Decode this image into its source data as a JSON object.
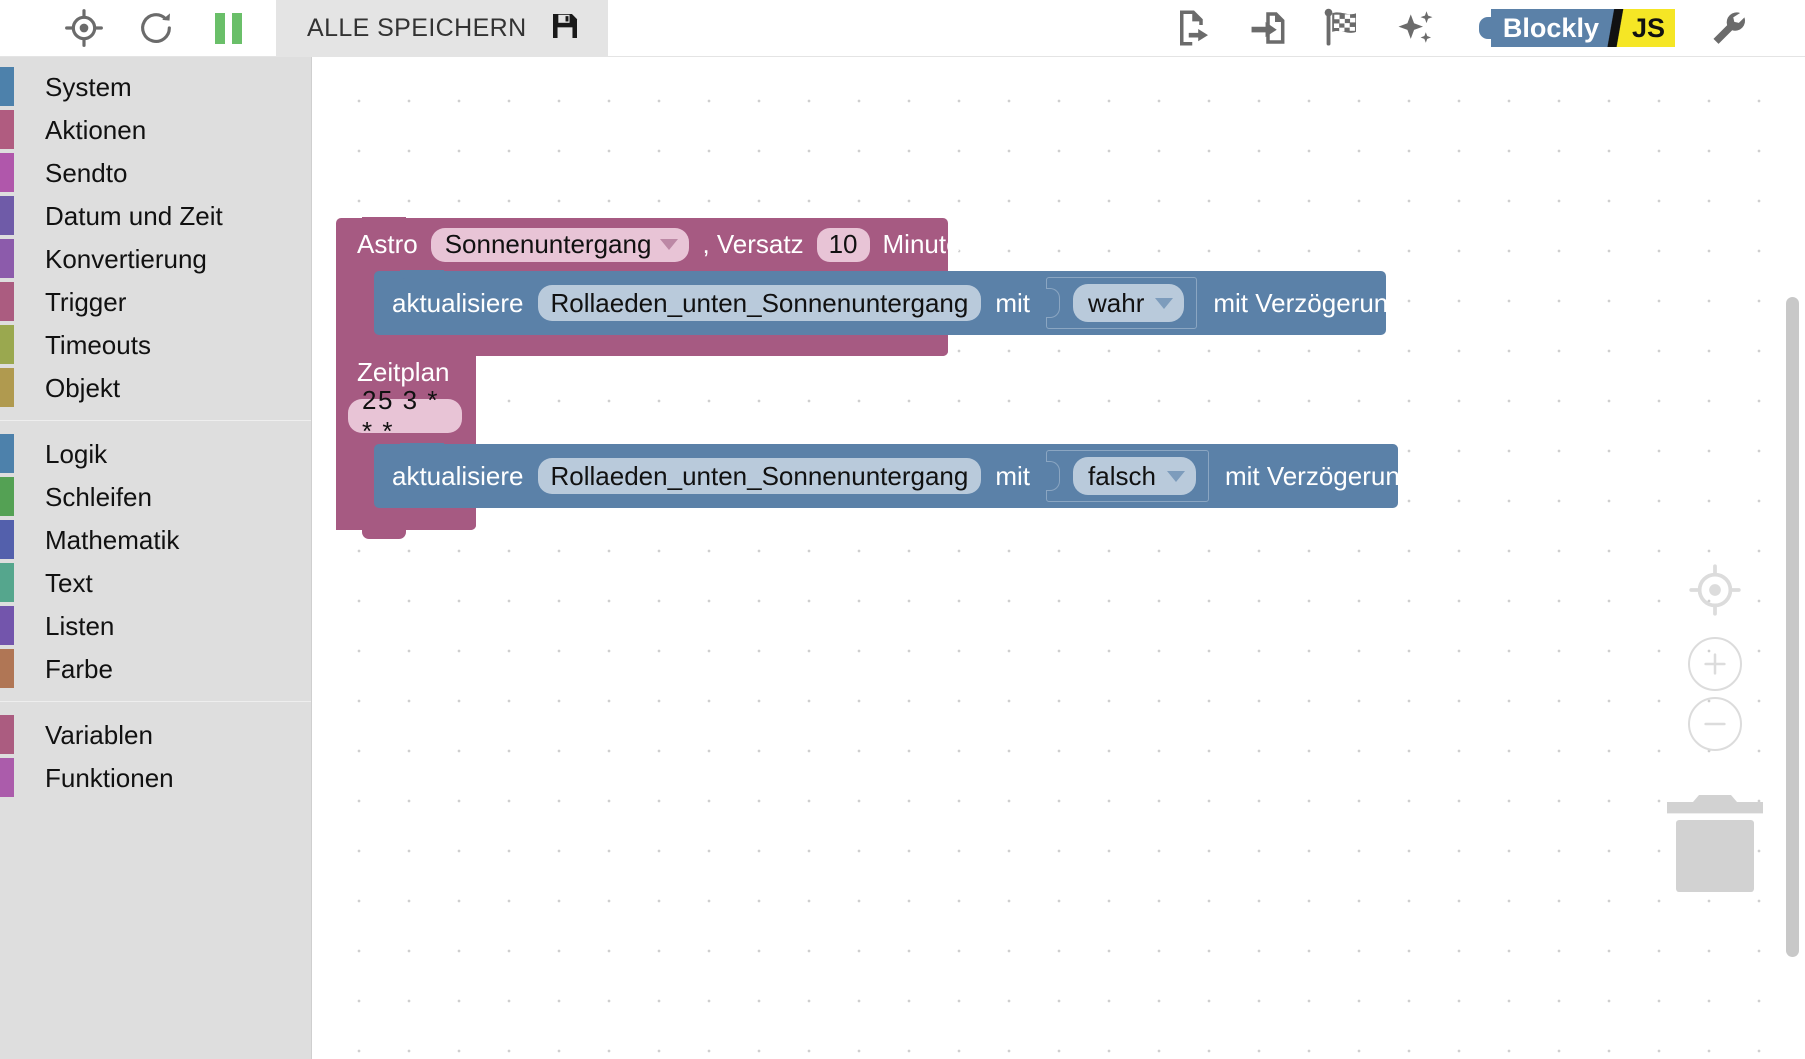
{
  "toolbar": {
    "left_icons": [
      {
        "name": "locate-icon",
        "title": "locate"
      },
      {
        "name": "reload-icon",
        "title": "reload"
      },
      {
        "name": "pause-icon",
        "title": "pause"
      }
    ],
    "save_all_label": "ALLE SPEICHERN",
    "save_icon": "floppy-disk-icon",
    "right_icons": [
      {
        "name": "export-blocks-icon",
        "title": "export"
      },
      {
        "name": "import-blocks-icon",
        "title": "import"
      },
      {
        "name": "checkered-flag-icon",
        "title": "checkpoint"
      },
      {
        "name": "sparkle-icon",
        "title": "magic"
      }
    ],
    "logo": {
      "blockly": "Blockly",
      "separator": "/",
      "js": "JS"
    },
    "settings_icon": "wrench-icon"
  },
  "sidebar": {
    "groups": [
      {
        "items": [
          {
            "label": "System",
            "color": "#4d81ab"
          },
          {
            "label": "Aktionen",
            "color": "#b05c80"
          },
          {
            "label": "Sendto",
            "color": "#b057ab"
          },
          {
            "label": "Datum und Zeit",
            "color": "#6f5ba8"
          },
          {
            "label": "Konvertierung",
            "color": "#8c5bab"
          },
          {
            "label": "Trigger",
            "color": "#ab5c80"
          },
          {
            "label": "Timeouts",
            "color": "#9aa84f"
          },
          {
            "label": "Objekt",
            "color": "#b09a4f"
          }
        ]
      },
      {
        "items": [
          {
            "label": "Logik",
            "color": "#4d81ab"
          },
          {
            "label": "Schleifen",
            "color": "#54a154"
          },
          {
            "label": "Mathematik",
            "color": "#5360ac"
          },
          {
            "label": "Text",
            "color": "#55a68d"
          },
          {
            "label": "Listen",
            "color": "#7355ac"
          },
          {
            "label": "Farbe",
            "color": "#b07655"
          }
        ]
      },
      {
        "items": [
          {
            "label": "Variablen",
            "color": "#ab5c80"
          },
          {
            "label": "Funktionen",
            "color": "#ab5cab"
          }
        ]
      }
    ]
  },
  "workspace": {
    "blocks": [
      {
        "type": "astro-trigger",
        "color": "#a65a82",
        "label": "Astro",
        "event": "Sonnenuntergang",
        "offset_label": ", Versatz",
        "offset_value": "10",
        "unit_label": "Minuten",
        "statement": {
          "type": "control-update",
          "color": "#5b81a8",
          "verb": "aktualisiere",
          "object_id": "Rollaeden_unten_Sonnenuntergang",
          "with_label": "mit",
          "value": "wahr",
          "delay_label": "mit Verzögerung",
          "delay_checked": false
        }
      },
      {
        "type": "schedule-trigger",
        "color": "#a65a82",
        "label": "Zeitplan",
        "cron": "25 3 * * *",
        "statement": {
          "type": "control-update",
          "color": "#5b81a8",
          "verb": "aktualisiere",
          "object_id": "Rollaeden_unten_Sonnenuntergang",
          "with_label": "mit",
          "value": "falsch",
          "delay_label": "mit Verzögerung",
          "delay_checked": false
        }
      }
    ],
    "controls": [
      {
        "name": "center-workspace-button",
        "glyph": "target"
      },
      {
        "name": "zoom-in-button",
        "glyph": "+"
      },
      {
        "name": "zoom-out-button",
        "glyph": "-"
      },
      {
        "name": "trash-can",
        "glyph": "trash"
      }
    ]
  }
}
